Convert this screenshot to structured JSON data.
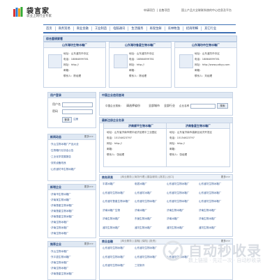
{
  "header": {
    "logo_title": "袋言家",
    "logo_sub": "袋业上网行业专家",
    "top_links": [
      "申请项目",
      "出售项目"
    ],
    "top_desc": "国土产品大全联联系统的中心信息及平台"
  },
  "nav": [
    "首页",
    "商务贸易",
    "商业金融",
    "工业制造",
    "电脑通讯",
    "生活服务",
    "再现生鲜",
    "农林牧渔",
    "招商明细",
    "其它行业"
  ],
  "recommended": {
    "title": "综合重磅要看",
    "cards": [
      {
        "name": "山东潍坊生物冰箱厂",
        "lines": [
          "地址：山东潍坊市中区",
          "电话：18864699781",
          "网址：http://",
          "邮箱：",
          "联系人：陈经理"
        ]
      },
      {
        "name": "山东潍坊鲁星生物冰箱厂",
        "lines": [
          "地址：山东潍坊市中区",
          "电话：18864699781",
          "网址：http://",
          "邮箱：",
          "联系人：陈经理"
        ]
      },
      {
        "name": "山东潍坊市生物冰箱厂",
        "lines": [
          "地址：山东潍坊市中区",
          "电话：18864699781",
          "网址：http://www.pdkyy.com",
          "邮箱：",
          "联系人：刘经理"
        ]
      }
    ]
  },
  "login": {
    "title": "用户登录",
    "user_label": "用户名",
    "pass_label": "密码",
    "login_btn": "登录",
    "register": "注册"
  },
  "news": {
    "title": "新闻动态",
    "more": "更多>>",
    "items": [
      "·东山生物冰箱厂产品大全",
      "·生物箱行业协会公告",
      "·工业化学发展报告",
      "·农机设备改良",
      "·山东潍坊市生物冰箱厂"
    ]
  },
  "new_ent": {
    "title": "新增企业",
    "more": "更多>>",
    "items": [
      "·济南市生物冰箱厂",
      "·济南某生物冰箱厂",
      "·济南鲁星生物冰箱厂",
      "·济南鲁星生物冰箱厂",
      "·济南鲁星生物冰箱厂",
      "·济南生物冰箱厂",
      "·济南生物冰箱厂",
      "·济南生物冰箱厂"
    ]
  },
  "recommend2": {
    "title": "推荐企业",
    "more": "更多>>",
    "items": [
      "·东山生物冰箱厂",
      "·东平县生物冰箱厂",
      "·济南生物冰箱厂",
      "·济南生物冰箱厂",
      "·济南鲁星生物冰箱厂",
      "·济南鲁星生物冰箱厂",
      "·济南鲁星生物冰箱厂",
      "·济南生物冰箱厂"
    ]
  },
  "search": {
    "title": "中国企业信用查询",
    "label": "中国企业搜索：",
    "province": "请选择省份",
    "city": "全部城市",
    "category": "全部行业",
    "keyword_label": "企业名称",
    "button": "搜索"
  },
  "latest": {
    "title": "最新注册企业名录",
    "cards": [
      {
        "name": "济南顺平生物冰箱厂",
        "lines": [
          "地址：山东省济南市顺平经济区顺平工业园区",
          "电话：15154623797",
          "网址：http://",
          "邮箱：",
          "联系人：张经理"
        ]
      },
      {
        "name": "济南鲁星生物冰箱厂",
        "lines": [
          "地址：山东省济南市高新区经济开发区",
          "电话：15154623797",
          "网址：http://",
          "邮箱：",
          "联系人：张经理"
        ]
      }
    ]
  },
  "section1": {
    "title": "商务贸易",
    "links": "[商业服务] [商务代理] [展会服务] [批发] [出口]",
    "more": "更多>>",
    "cells": [
      [
        "平泉冰箱厂",
        "临邑冰箱厂",
        "山东潍坊生物冰箱厂",
        "山东潍坊生物冰箱厂"
      ],
      [
        "山东潍坊生物冰箱厂",
        "山东潍坊冰箱厂",
        "山东潍坊生物冰箱厂",
        "山东潍坊生物冰箱厂"
      ],
      [
        "山东潍坊鲁星生物冰箱厂",
        "山东潍坊生物冰箱厂",
        "山东潍坊生物冰箱厂",
        "山东潍坊生物冰箱厂"
      ],
      [
        "济南冰箱厂生物",
        "济南冰箱厂",
        "济南生物冰箱厂",
        "济南生物冰箱厂"
      ],
      [
        "济南生物冰箱厂",
        "东营生物冰箱厂",
        "济南冰箱厂",
        "济南生物冰箱厂"
      ],
      [
        "潍坊生物冰箱厂",
        "潍坊生物冰箱厂",
        "潍坊生物冰箱厂",
        "潍坊生物冰箱厂"
      ]
    ]
  },
  "section2": {
    "title": "商业金融",
    "links": "[商业服务] [金融] [保险] [投资]",
    "more": "更多>>",
    "cells": [
      [
        "山东潍坊生物冰箱厂",
        "山东潍坊生物冰箱厂",
        "",
        ""
      ],
      [
        "山东潍坊生物冰箱厂",
        "山东潍坊生物冰箱厂",
        "山东潍坊生物冰箱厂",
        ""
      ],
      [
        "山东潍坊生物冰箱厂",
        "三花制冷",
        "",
        ""
      ]
    ]
  },
  "watermark": {
    "title": "自动秒收录",
    "sub": "数上链接 · 先过一次 · 自动秒收录"
  }
}
